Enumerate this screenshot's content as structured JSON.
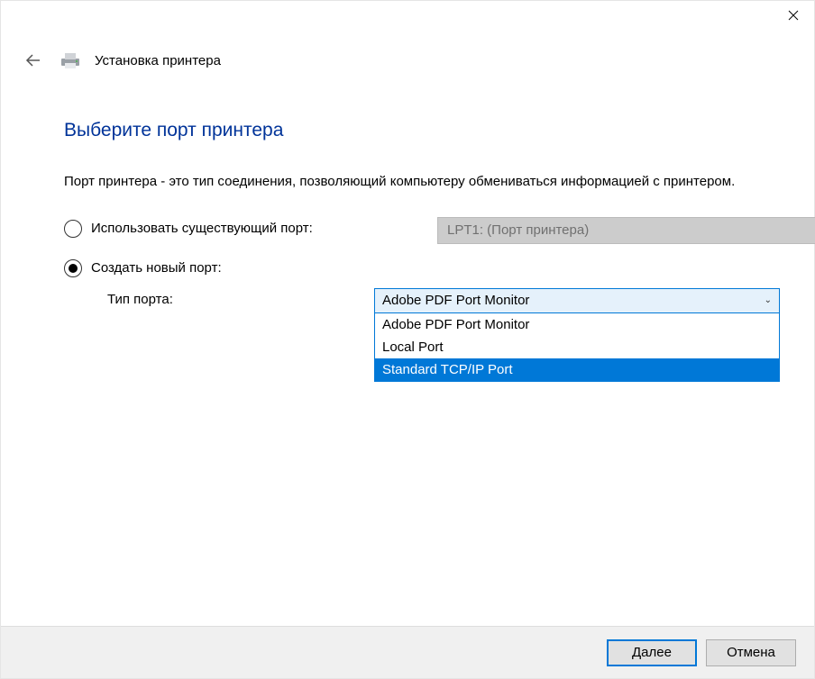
{
  "titlebar": {
    "close_icon": "close"
  },
  "header": {
    "back_icon": "back",
    "wizard_title": "Установка принтера"
  },
  "page": {
    "heading": "Выберите порт принтера",
    "description": "Порт принтера - это тип соединения, позволяющий компьютеру обмениваться информацией с принтером."
  },
  "options": {
    "use_existing_label": "Использовать существующий порт:",
    "existing_port_value": "LPT1: (Порт принтера)",
    "create_new_label": "Создать новый порт:",
    "port_type_label": "Тип порта:",
    "selected_port_type": "Adobe PDF Port Monitor",
    "port_type_items": [
      "Adobe PDF Port Monitor",
      "Local Port",
      "Standard TCP/IP Port"
    ],
    "highlighted_index": 2
  },
  "footer": {
    "next_label": "Далее",
    "cancel_label": "Отмена"
  }
}
